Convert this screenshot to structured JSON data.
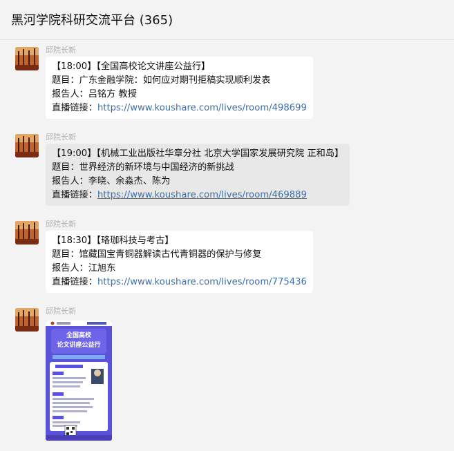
{
  "chat": {
    "title": "黑河学院科研交流平台 (365)"
  },
  "messages": [
    {
      "sender": "邱院长新",
      "lines": [
        "【18:00】【全国高校论文讲座公益行】",
        "题目：广东金融学院：如何应对期刊拒稿实现顺利发表",
        "报告人：吕铭方 教授"
      ],
      "link_prefix": "直播链接：",
      "link": "https://www.koushare.com/lives/room/498699"
    },
    {
      "sender": "邱院长新",
      "lines": [
        "【19:00】【机械工业出版社华章分社 北京大学国家发展研究院 正和岛】",
        "题目：世界经济的新环境与中国经济的新挑战",
        "报告人：李晓、余淼杰、陈为"
      ],
      "link_prefix": "直播链接：",
      "link": "https://www.koushare.com/lives/room/469889"
    },
    {
      "sender": "邱院长新",
      "lines": [
        "【18:30】【珞珈科技与考古】",
        "题目：馆藏国宝青铜器解读古代青铜器的保护与修复",
        "报告人：江旭东"
      ],
      "link_prefix": "直播链接：",
      "link": "https://www.koushare.com/lives/room/775436"
    },
    {
      "sender": "邱院长新",
      "image": {
        "headline": "全国高校论文讲座公益行"
      }
    }
  ],
  "colors": {
    "background": "#f3f3f3",
    "bubble": "#ffffff",
    "bubble_selected": "#e8e8e8",
    "link": "#3d6fa8",
    "sender": "#b2b2b2"
  },
  "icons": {
    "avatar": "autumn-forest-avatar"
  }
}
